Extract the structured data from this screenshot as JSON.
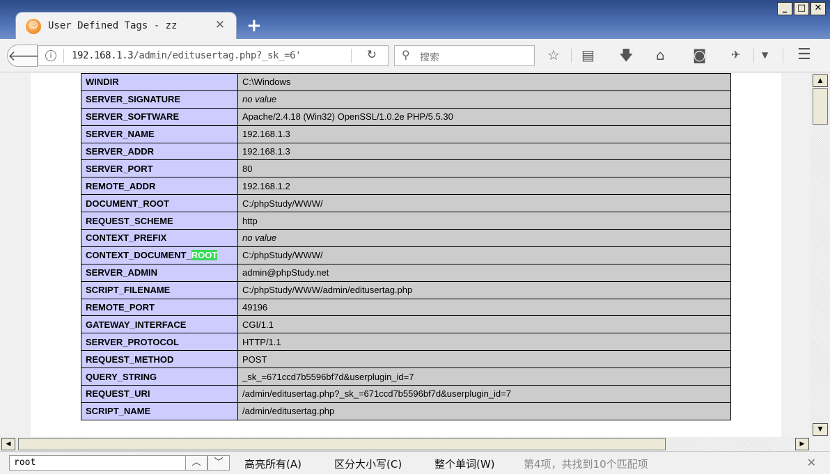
{
  "window": {
    "tab_title": "User Defined Tags - zz",
    "tab_icon": "firefox-logo-icon",
    "new_tab_label": "+",
    "min_label": "_",
    "max_label": "□",
    "close_label": "✕"
  },
  "toolbar": {
    "url_host": "192.168.1.3",
    "url_path": "/admin/editusertag.php?_sk_=6'",
    "search_placeholder": "搜索",
    "icons": [
      "back-icon",
      "info-icon",
      "reload-icon",
      "search-icon",
      "bookmark-star-icon",
      "reading-list-icon",
      "download-icon",
      "home-icon",
      "pocket-icon",
      "extension-icon",
      "menu-icon"
    ]
  },
  "env_table": {
    "key_bg": "#ccccff",
    "value_bg": "#cccccc",
    "highlight_color": "#38d958",
    "rows": [
      {
        "key": "WINDIR",
        "value": "C:\\Windows"
      },
      {
        "key": "SERVER_SIGNATURE",
        "value": "no value",
        "italic": true
      },
      {
        "key": "SERVER_SOFTWARE",
        "value": "Apache/2.4.18 (Win32) OpenSSL/1.0.2e PHP/5.5.30"
      },
      {
        "key": "SERVER_NAME",
        "value": "192.168.1.3"
      },
      {
        "key": "SERVER_ADDR",
        "value": "192.168.1.3"
      },
      {
        "key": "SERVER_PORT",
        "value": "80"
      },
      {
        "key": "REMOTE_ADDR",
        "value": "192.168.1.2"
      },
      {
        "key": "DOCUMENT_ROOT",
        "value": "C:/phpStudy/WWW/"
      },
      {
        "key": "REQUEST_SCHEME",
        "value": "http"
      },
      {
        "key": "CONTEXT_PREFIX",
        "value": "no value",
        "italic": true
      },
      {
        "key": "CONTEXT_DOCUMENT_",
        "key_highlight": "ROOT",
        "value": "C:/phpStudy/WWW/"
      },
      {
        "key": "SERVER_ADMIN",
        "value": "admin@phpStudy.net"
      },
      {
        "key": "SCRIPT_FILENAME",
        "value": "C:/phpStudy/WWW/admin/editusertag.php"
      },
      {
        "key": "REMOTE_PORT",
        "value": "49196"
      },
      {
        "key": "GATEWAY_INTERFACE",
        "value": "CGI/1.1"
      },
      {
        "key": "SERVER_PROTOCOL",
        "value": "HTTP/1.1"
      },
      {
        "key": "REQUEST_METHOD",
        "value": "POST"
      },
      {
        "key": "QUERY_STRING",
        "value": "_sk_=671ccd7b5596bf7d&userplugin_id=7"
      },
      {
        "key": "REQUEST_URI",
        "value": "/admin/editusertag.php?_sk_=671ccd7b5596bf7d&userplugin_id=7"
      },
      {
        "key": "SCRIPT_NAME",
        "value": "/admin/editusertag.php"
      }
    ]
  },
  "findbar": {
    "query": "root",
    "highlight_all": "高亮所有(A)",
    "match_case": "区分大小写(C)",
    "whole_words": "整个单词(W)",
    "status": "第4项，共找到10个匹配项"
  }
}
